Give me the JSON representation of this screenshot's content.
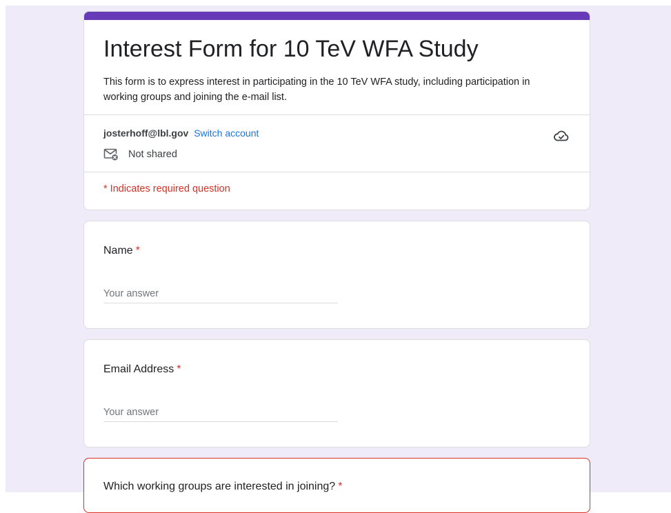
{
  "form": {
    "title": "Interest Form for 10 TeV WFA Study",
    "description": "This form is to express interest in participating in the 10 TeV WFA study, including participation in working groups and joining the e-mail list.",
    "accent_color": "#673ab7"
  },
  "account": {
    "email": "josterhoff@lbl.gov",
    "switch_label": "Switch account",
    "sharing_status": "Not shared",
    "sync_icon": "cloud-check-icon",
    "mail_icon": "mail-off-icon"
  },
  "required_note": "* Indicates required question",
  "questions": [
    {
      "title": "Name",
      "required_mark": "*",
      "value": "",
      "placeholder": "Your answer"
    },
    {
      "title": "Email Address",
      "required_mark": "*",
      "value": "",
      "placeholder": "Your answer"
    },
    {
      "title": "Which working groups are interested in joining?",
      "required_mark": "*"
    }
  ],
  "colors": {
    "background": "#efebf8",
    "required": "#d93025",
    "link": "#1a73e8"
  }
}
